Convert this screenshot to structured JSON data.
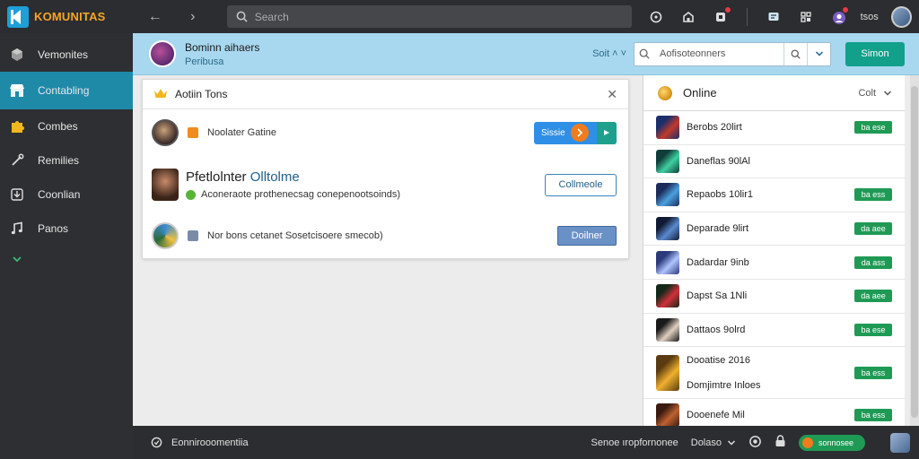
{
  "topbar": {
    "app_name": "KOMUNITAS",
    "search_placeholder": "Search",
    "user_name": "tsos",
    "back_icon": "arrow-left-icon",
    "forward_icon": "chevron-right-icon"
  },
  "sidebar": {
    "items": [
      {
        "label": "Vemonites",
        "icon": "cube-icon"
      },
      {
        "label": "Contabling",
        "icon": "storefront-icon",
        "active": true
      },
      {
        "label": "Combes",
        "icon": "puzzle-icon"
      },
      {
        "label": "Remilies",
        "icon": "wrench-icon"
      },
      {
        "label": "Coonlian",
        "icon": "download-icon"
      },
      {
        "label": "Panos",
        "icon": "music-icon"
      }
    ]
  },
  "header": {
    "title": "Bominn aihaers",
    "subtitle": "Peribusa",
    "sort_label": "Soit ˄ ˅",
    "search_placeholder": "Aofisoteonners",
    "primary_button": "Simon"
  },
  "card": {
    "heading": "Aotiin Tons",
    "rows": [
      {
        "text": "Noolater Gatine",
        "button_label": "Sissie"
      },
      {
        "title_prefix": "Pfetlolnter ",
        "title_highlight": "Olltolme",
        "subtitle": "Aconeraote prothenecsag conepenootsoinds)",
        "button_label": "Collmeole"
      },
      {
        "text": "Nor bons cetanet Sosetcisoere smecob)",
        "button_label": "Doilner"
      }
    ]
  },
  "right_panel": {
    "title": "Online",
    "sort_label": "Colt",
    "items": [
      {
        "label": "Berobs 20lirt",
        "badge": "ba ese",
        "thumb": [
          "#1b2f6a",
          "#c0392b"
        ]
      },
      {
        "label": "Daneflas 90lAl",
        "badge": "",
        "thumb": [
          "#0f3d3a",
          "#3fd0a0"
        ]
      },
      {
        "label": "Repaobs 10lir1",
        "badge": "ba ess",
        "thumb": [
          "#1c2c5a",
          "#4aa0e0"
        ]
      },
      {
        "label": "Deparade 9lirt",
        "badge": "da aee",
        "thumb": [
          "#111a33",
          "#5a8ad0"
        ]
      },
      {
        "label": "Dadardar 9inb",
        "badge": "da ass",
        "thumb": [
          "#2a3a7a",
          "#b0c4ff"
        ]
      },
      {
        "label": "Dapst Sa 1Nli",
        "badge": "da aee",
        "thumb": [
          "#14281a",
          "#d0303a"
        ]
      },
      {
        "label": "Dattaos 9olrd",
        "badge": "ba ese",
        "thumb": [
          "#1a1a1a",
          "#e0d0c0"
        ]
      },
      {
        "label": "Dooatise 2016",
        "label2": "Domjimtre Inloes",
        "badge": "ba ess",
        "thumb": [
          "#5a3a10",
          "#f0b030"
        ]
      },
      {
        "label": "Dooenefe Mil",
        "badge": "ba ess",
        "thumb": [
          "#3a1a10",
          "#c06030"
        ]
      }
    ]
  },
  "bottombar": {
    "status": "Eonnirooomentiia",
    "right_text": "Senoe ıropfornonee",
    "right_count": "Dolaso",
    "pill_label": "sonnosee"
  },
  "colors": {
    "accent": "#1f8aa8",
    "header_bg": "#a8d8ef",
    "primary": "#12a08a",
    "badge_green": "#1f9a55"
  }
}
